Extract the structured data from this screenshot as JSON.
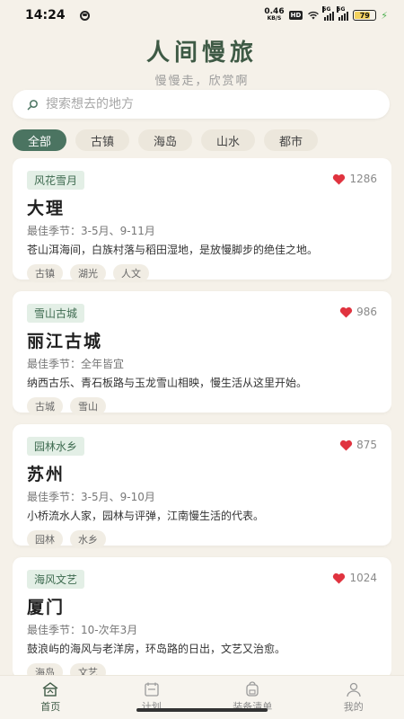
{
  "status_bar": {
    "time": "14:24",
    "net_speed": "0.46",
    "net_unit": "KB/S",
    "hd": "HD",
    "sig1": "5G",
    "sig2": "5G",
    "battery": "79",
    "battery_level": 0.79
  },
  "header": {
    "title": "人间慢旅",
    "subtitle": "慢慢走，欣赏啊"
  },
  "search": {
    "placeholder": "搜索想去的地方"
  },
  "filters": [
    {
      "label": "全部",
      "active": true
    },
    {
      "label": "古镇",
      "active": false
    },
    {
      "label": "海岛",
      "active": false
    },
    {
      "label": "山水",
      "active": false
    },
    {
      "label": "都市",
      "active": false
    }
  ],
  "destinations": [
    {
      "tag": "风花雪月",
      "likes": "1286",
      "name": "大理",
      "season": "最佳季节：3-5月、9-11月",
      "desc": "苍山洱海间，白族村落与稻田湿地，是放慢脚步的绝佳之地。",
      "tags": [
        "古镇",
        "湖光",
        "人文"
      ]
    },
    {
      "tag": "雪山古城",
      "likes": "986",
      "name": "丽江古城",
      "season": "最佳季节：全年皆宜",
      "desc": "纳西古乐、青石板路与玉龙雪山相映，慢生活从这里开始。",
      "tags": [
        "古城",
        "雪山"
      ]
    },
    {
      "tag": "园林水乡",
      "likes": "875",
      "name": "苏州",
      "season": "最佳季节：3-5月、9-10月",
      "desc": "小桥流水人家，园林与评弹，江南慢生活的代表。",
      "tags": [
        "园林",
        "水乡"
      ]
    },
    {
      "tag": "海风文艺",
      "likes": "1024",
      "name": "厦门",
      "season": "最佳季节：10-次年3月",
      "desc": "鼓浪屿的海风与老洋房，环岛路的日出，文艺又治愈。",
      "tags": [
        "海岛",
        "文艺"
      ]
    }
  ],
  "tabbar": [
    {
      "label": "首页",
      "icon": "home-icon",
      "active": true
    },
    {
      "label": "计划",
      "icon": "calendar-icon",
      "active": false
    },
    {
      "label": "装备清单",
      "icon": "backpack-icon",
      "active": false
    },
    {
      "label": "我的",
      "icon": "profile-icon",
      "active": false
    }
  ],
  "colors": {
    "accent": "#4b7461",
    "title": "#3e5a45",
    "heart": "#e0333f",
    "background": "#f5f1e9"
  }
}
